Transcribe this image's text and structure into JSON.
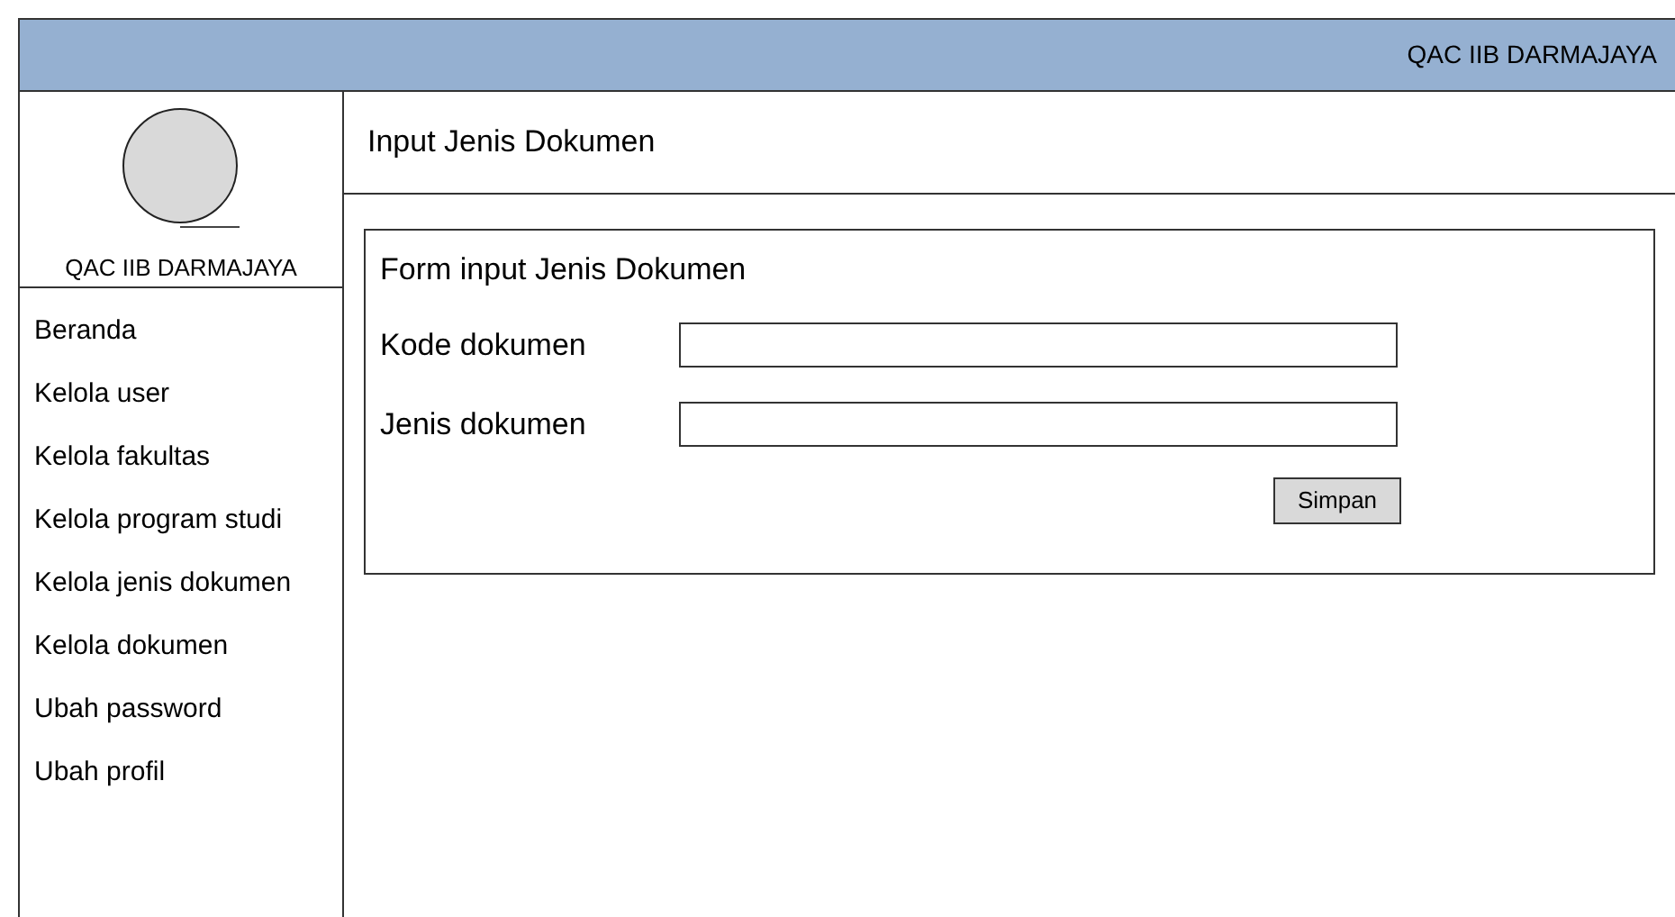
{
  "header": {
    "title": "QAC IIB DARMAJAYA"
  },
  "sidebar": {
    "title": "QAC IIB DARMAJAYA",
    "items": [
      "Beranda",
      "Kelola user",
      "Kelola fakultas",
      "Kelola program studi",
      "Kelola jenis dokumen",
      "Kelola dokumen",
      "Ubah password",
      "Ubah profil"
    ]
  },
  "page": {
    "title": "Input Jenis Dokumen"
  },
  "form": {
    "title": "Form input Jenis Dokumen",
    "fields": [
      {
        "label": "Kode dokumen"
      },
      {
        "label": "Jenis dokumen"
      }
    ],
    "button": "Simpan"
  }
}
